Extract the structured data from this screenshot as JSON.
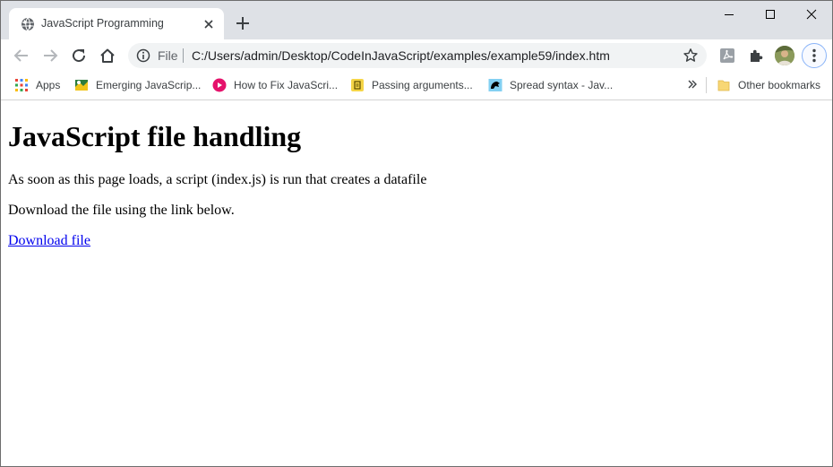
{
  "tab": {
    "title": "JavaScript Programming",
    "favicon": "globe-icon"
  },
  "window_controls": [
    "minimize-icon",
    "maximize-icon",
    "close-icon"
  ],
  "omnibox": {
    "scheme": "File",
    "url": "C:/Users/admin/Desktop/CodeInJavaScript/examples/example59/index.htm"
  },
  "bookmarks": {
    "items": [
      {
        "label": "Apps",
        "icon": "apps-grid-icon"
      },
      {
        "label": "Emerging JavaScrip...",
        "icon": "emerging-js-favicon"
      },
      {
        "label": "How to Fix JavaScri...",
        "icon": "red-circle-favicon"
      },
      {
        "label": "Passing arguments...",
        "icon": "yellow-js-favicon"
      },
      {
        "label": "Spread syntax - Jav...",
        "icon": "mdn-favicon"
      }
    ],
    "other_label": "Other bookmarks"
  },
  "page": {
    "heading": "JavaScript file handling",
    "paragraph1": "As soon as this page loads, a script (index.js) is run that creates a datafile",
    "paragraph2": "Download the file using the link below.",
    "link_text": "Download file"
  },
  "colors": {
    "tabstrip_bg": "#dee1e6",
    "omnibox_bg": "#f1f3f4",
    "link": "#0000ee"
  }
}
